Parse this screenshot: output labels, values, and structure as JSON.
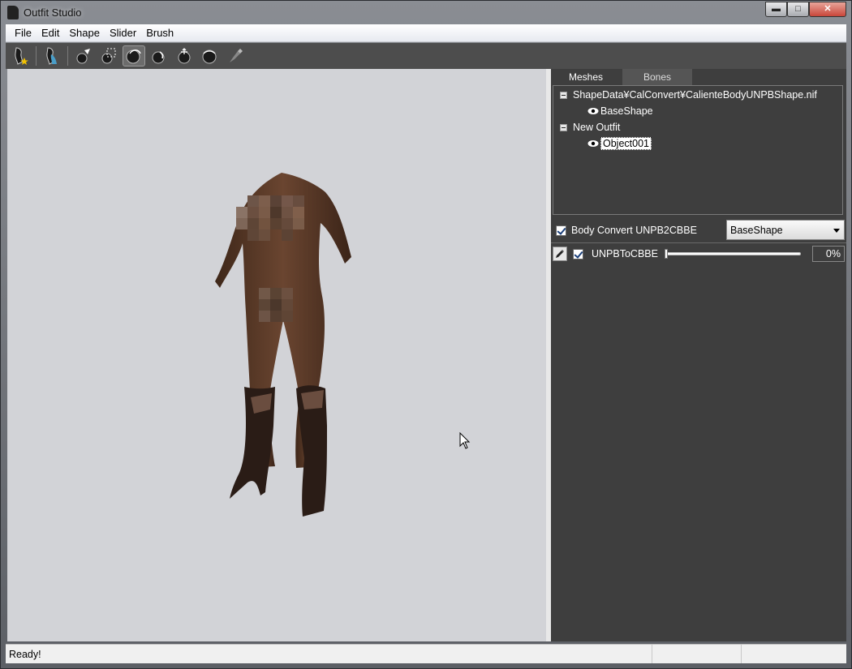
{
  "window": {
    "title": "Outfit Studio",
    "minimize": "▬",
    "maximize": "□",
    "close": "✕"
  },
  "menu": [
    "File",
    "Edit",
    "Shape",
    "Slider",
    "Brush"
  ],
  "toolbar": {
    "tools": [
      "new-project-icon",
      "load-outfit-icon",
      "select-brush-icon",
      "mask-brush-icon",
      "inflate-brush-icon",
      "deflate-brush-icon",
      "move-brush-icon",
      "smooth-brush-icon",
      "weight-brush-icon"
    ],
    "active_tool": "inflate-brush-icon"
  },
  "panel": {
    "tabs": {
      "meshes": "Meshes",
      "bones": "Bones"
    },
    "tree": {
      "group1": "ShapeData¥CalConvert¥CalienteBodyUNPBShape.nif",
      "group1_child": "BaseShape",
      "group2": "New Outfit",
      "group2_child": "Object001"
    },
    "convert": {
      "label": "Body Convert UNPB2CBBE",
      "checked": true,
      "shape_select": "BaseShape"
    },
    "slider": {
      "name": "UNPBToCBBE",
      "checked": true,
      "value_text": "0%",
      "value": 0
    }
  },
  "status": {
    "text": "Ready!"
  },
  "colors": {
    "viewport_bg": "#d2d3d7",
    "panel_bg": "#3e3e3e",
    "toolbar_bg": "#4d4d4d",
    "model_skin": "#5a3a28"
  }
}
